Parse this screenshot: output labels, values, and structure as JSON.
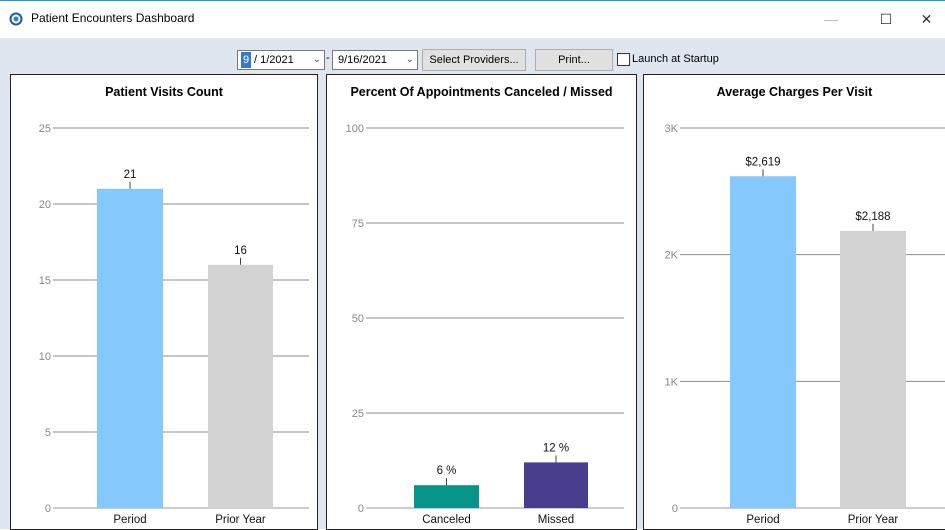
{
  "window": {
    "title": "Patient Encounters Dashboard",
    "minimize": "—",
    "maximize": "☐",
    "close": "✕"
  },
  "toolbar": {
    "start_date_highlight": "9",
    "start_date_rest": "/ 1/2021",
    "separator": "-",
    "end_date": "9/16/2021",
    "select_providers": "Select Providers...",
    "print": "Print...",
    "launch_at_startup": "Launch at Startup",
    "launch_checked": false
  },
  "colors": {
    "period": "#85c8fb",
    "prior_year": "#d3d3d3",
    "canceled": "#079488",
    "missed": "#493e8d",
    "highlight": "#3478d4"
  },
  "chart_data": [
    {
      "type": "bar",
      "title": "Patient Visits Count",
      "categories": [
        "Period",
        "Prior Year"
      ],
      "values": [
        21,
        16
      ],
      "value_labels": [
        "21",
        "16"
      ],
      "bar_colors": [
        "#85c8fb",
        "#d3d3d3"
      ],
      "ylim": [
        0,
        25
      ],
      "yticks": [
        0,
        5,
        10,
        15,
        20,
        25
      ],
      "ytick_labels": [
        "0",
        "5",
        "10",
        "15",
        "20",
        "25"
      ],
      "grid": true
    },
    {
      "type": "bar",
      "title": "Percent Of Appointments Canceled / Missed",
      "categories": [
        "Canceled",
        "Missed"
      ],
      "values": [
        6,
        12
      ],
      "value_labels": [
        "6 %",
        "12 %"
      ],
      "bar_colors": [
        "#079488",
        "#493e8d"
      ],
      "ylim": [
        0,
        100
      ],
      "yticks": [
        0,
        25,
        50,
        75,
        100
      ],
      "ytick_labels": [
        "0",
        "25",
        "50",
        "75",
        "100"
      ],
      "grid": true
    },
    {
      "type": "bar",
      "title": "Average Charges Per Visit",
      "categories": [
        "Period",
        "Prior Year"
      ],
      "values": [
        2619,
        2188
      ],
      "value_labels": [
        "$2,619",
        "$2,188"
      ],
      "bar_colors": [
        "#85c8fb",
        "#d3d3d3"
      ],
      "ylim": [
        0,
        3000
      ],
      "yticks": [
        0,
        1000,
        2000,
        3000
      ],
      "ytick_labels": [
        "0",
        "1K",
        "2K",
        "3K"
      ],
      "grid": true
    }
  ]
}
